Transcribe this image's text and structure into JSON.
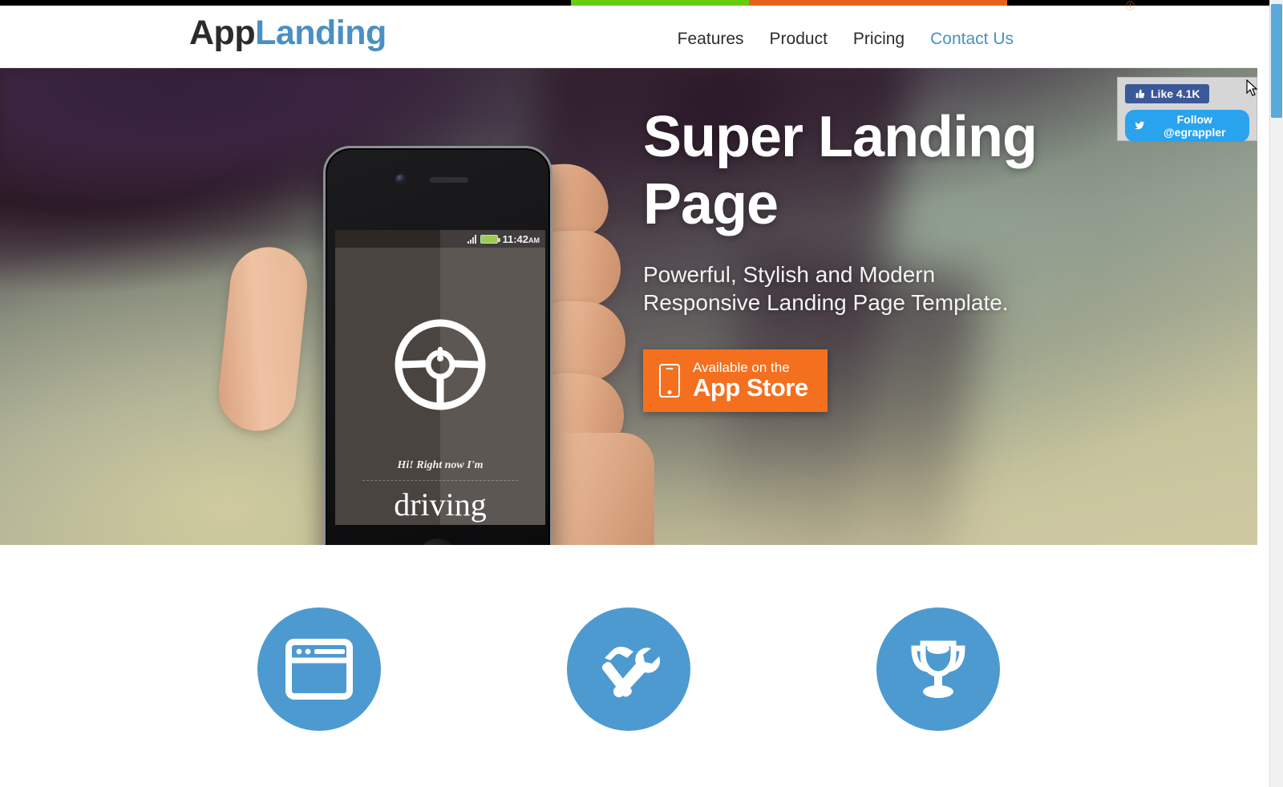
{
  "browser": {
    "top_strip_colors": [
      "#000000",
      "#66cc10",
      "#e8631a",
      "#000000"
    ],
    "top_glyph": "ⓘ",
    "scrollbar_color": "#5aa9dd"
  },
  "header": {
    "logo_part_one": "App",
    "logo_part_two": "Landing",
    "logo_color_one": "#2b2b2b",
    "logo_color_two": "#4a90c4",
    "nav": [
      {
        "label": "Features",
        "active": false
      },
      {
        "label": "Product",
        "active": false
      },
      {
        "label": "Pricing",
        "active": false
      },
      {
        "label": "Contact Us",
        "active": true
      }
    ]
  },
  "hero": {
    "title_line_1": "Super Landing",
    "title_line_2": "Page",
    "subtitle_line_1": "Powerful, Stylish and Modern",
    "subtitle_line_2": "Responsive Landing Page Template.",
    "cta": {
      "small_label": "Available on the",
      "big_label": "App Store",
      "color": "#f4701f"
    },
    "phone": {
      "status_time": "11:42",
      "status_ampm": "AM",
      "screen_tagline": "Hi! Right now I'm",
      "screen_status": "driving",
      "battery_color": "#8ec63f"
    }
  },
  "social": {
    "facebook_label": "Like 4.1K",
    "facebook_color": "#3b5998",
    "twitter_label": "Follow @egrappler",
    "twitter_color": "#2aa3ef"
  },
  "features": {
    "accent_color": "#4d9ad1",
    "items": [
      {
        "icon": "browser-window-icon",
        "title": ""
      },
      {
        "icon": "hammer-wrench-icon",
        "title": ""
      },
      {
        "icon": "trophy-icon",
        "title": ""
      }
    ]
  }
}
